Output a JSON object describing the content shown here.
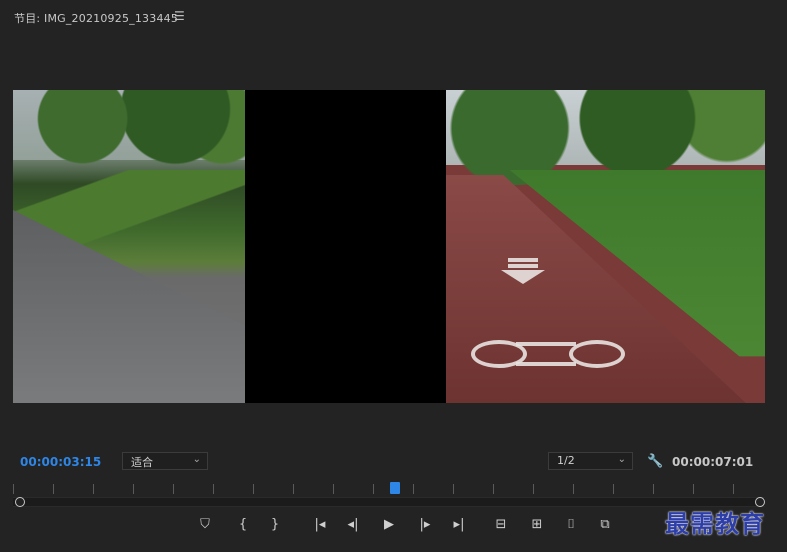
{
  "panel": {
    "title": "节目: IMG_20210925_133445",
    "menu_icon": "hamburger-menu-icon"
  },
  "playback": {
    "current_timecode": "00:00:03:15",
    "fit_value": "适合",
    "resolution_value": "1/2",
    "duration_timecode": "00:00:07:01",
    "settings_icon": "wrench-icon"
  },
  "transport": {
    "buttons": [
      {
        "name": "add-marker-button",
        "icon": "marker-icon"
      },
      {
        "name": "mark-in-button",
        "icon": "mark-in-icon"
      },
      {
        "name": "mark-out-button",
        "icon": "mark-out-icon"
      },
      {
        "name": "go-to-in-button",
        "icon": "go-to-in-icon"
      },
      {
        "name": "step-back-button",
        "icon": "step-back-icon"
      },
      {
        "name": "play-button",
        "icon": "play-icon"
      },
      {
        "name": "step-forward-button",
        "icon": "step-forward-icon"
      },
      {
        "name": "go-to-out-button",
        "icon": "go-to-out-icon"
      },
      {
        "name": "lift-button",
        "icon": "lift-icon"
      },
      {
        "name": "extract-button",
        "icon": "extract-icon"
      },
      {
        "name": "export-frame-button",
        "icon": "camera-icon"
      },
      {
        "name": "compare-view-button",
        "icon": "compare-icon"
      }
    ]
  },
  "watermark": {
    "text": "最需教育"
  },
  "colors": {
    "accent": "#2e86e6",
    "panel_bg": "#232323",
    "text": "#c7c7c7"
  }
}
